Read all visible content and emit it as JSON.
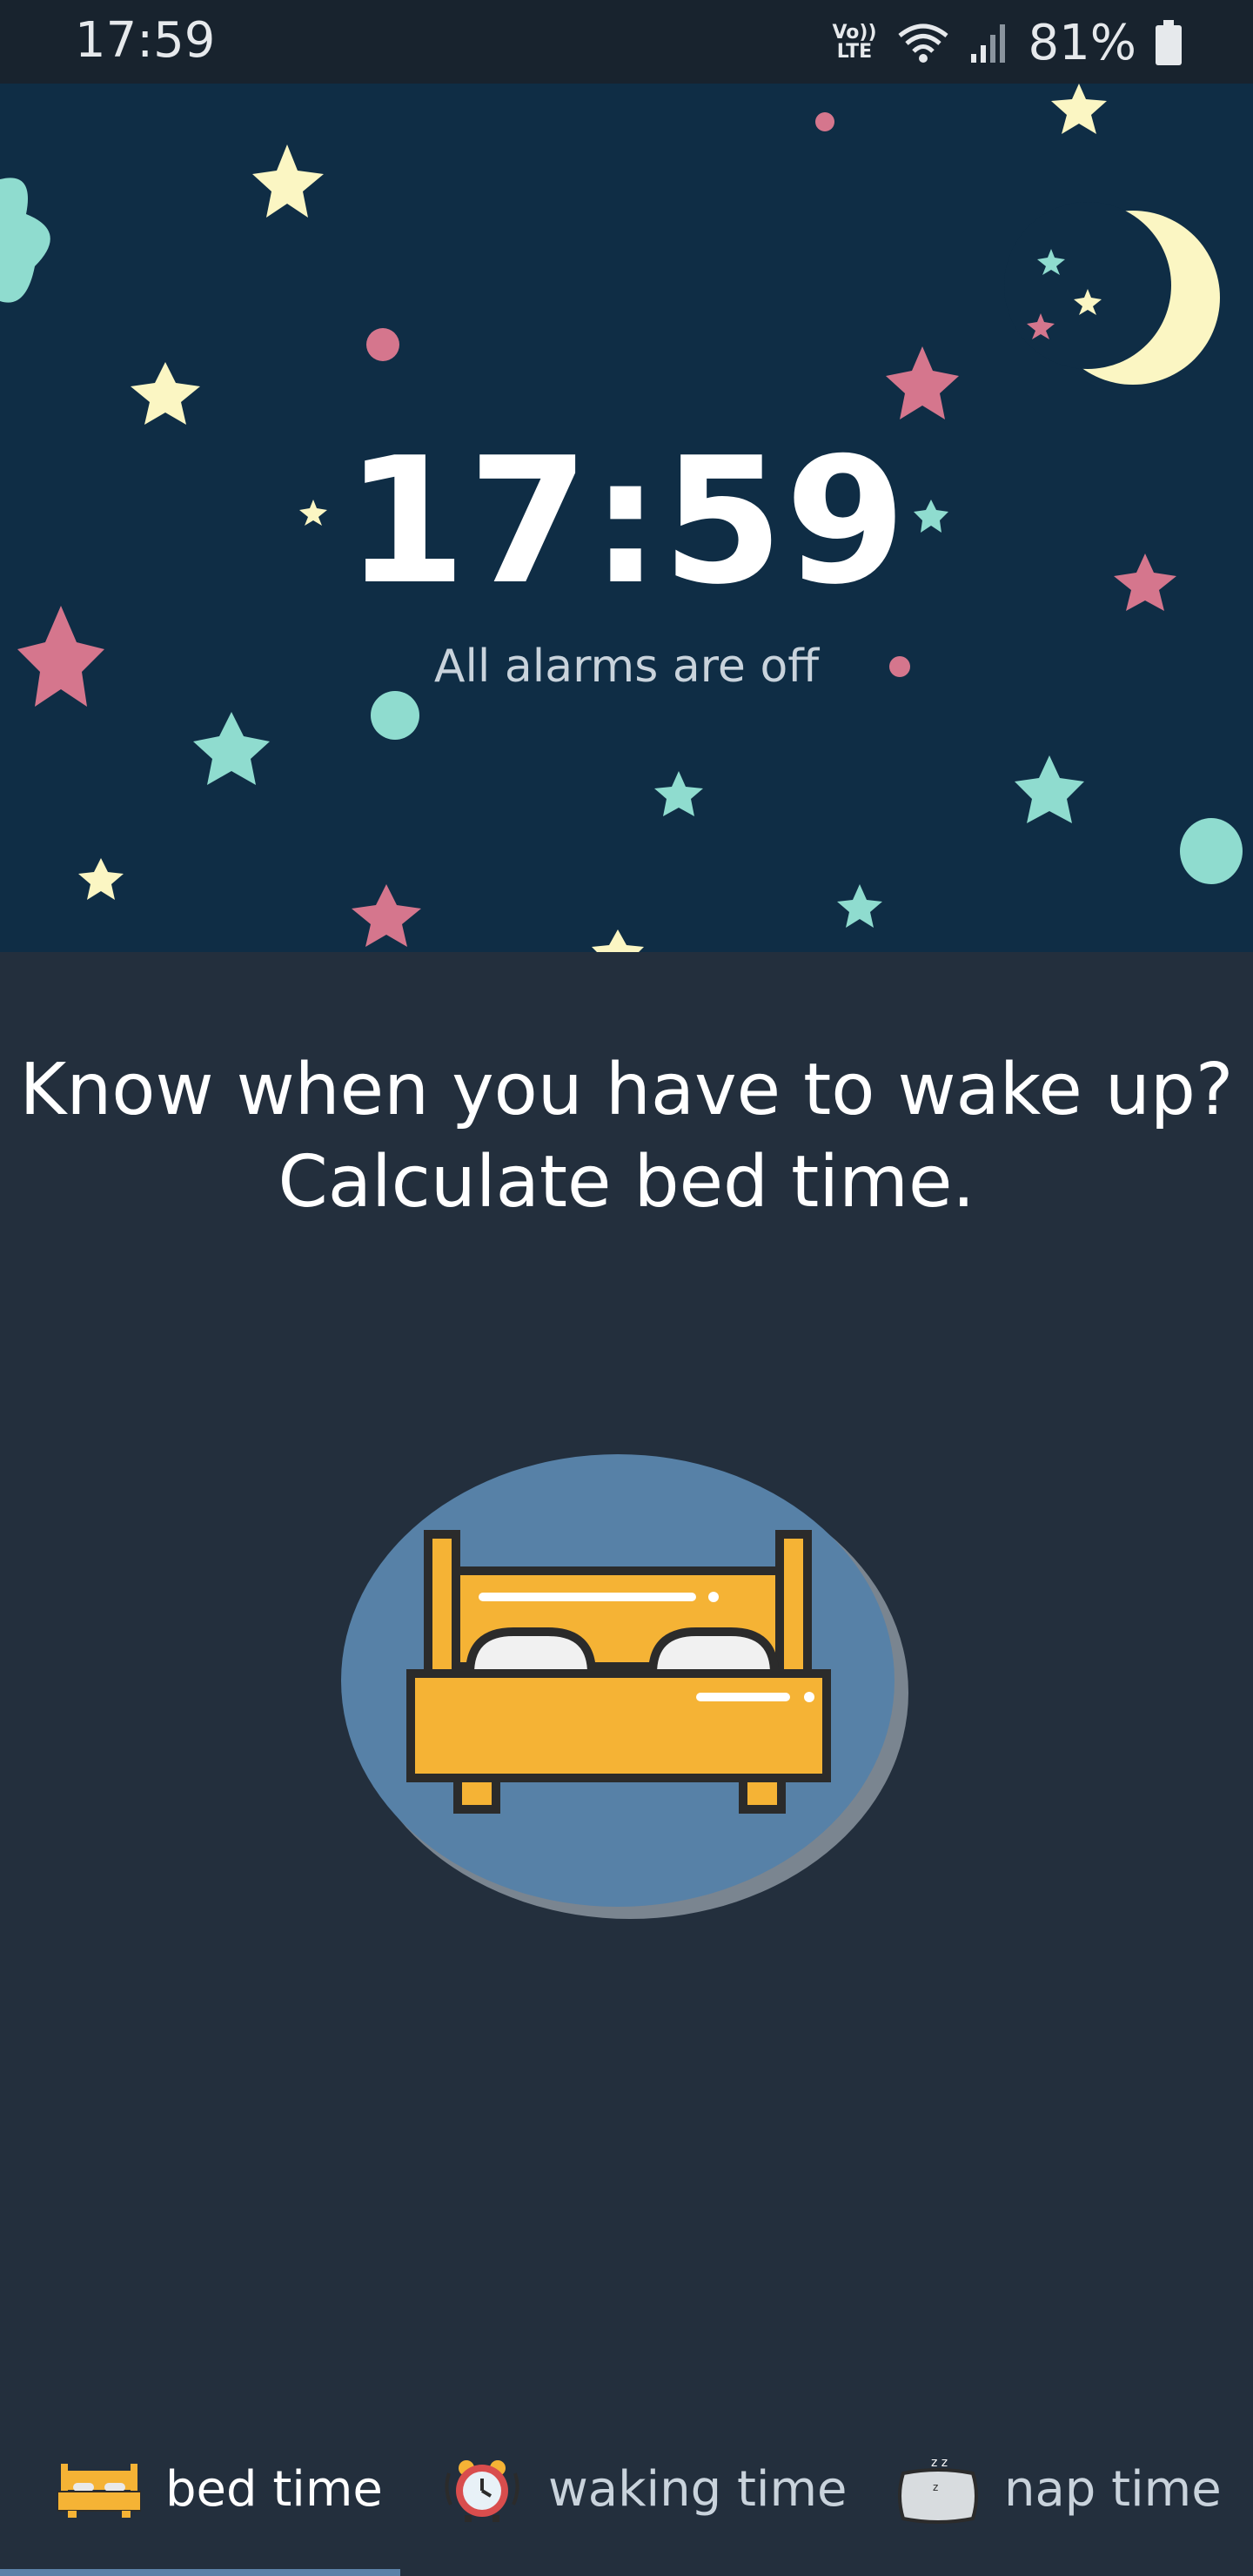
{
  "status_bar": {
    "time": "17:59",
    "network": "VoLTE",
    "volte_top": "Vo))",
    "volte_bottom": "LTE",
    "battery": "81%"
  },
  "header": {
    "clock": "17:59",
    "alarm_status": "All alarms are off"
  },
  "prompt": {
    "line1": "Know when you have to wake up?",
    "line2": "Calculate bed time."
  },
  "tabs": [
    {
      "label": "bed time",
      "icon": "bed-icon",
      "active": true
    },
    {
      "label": "waking time",
      "icon": "alarm-clock-icon",
      "active": false
    },
    {
      "label": "nap time",
      "icon": "pillow-icon",
      "active": false
    }
  ],
  "colors": {
    "background": "#232f3d",
    "header": "#0f2d45",
    "accent_teal": "#8fdccf",
    "accent_pink": "#d5768d",
    "accent_yellow": "#fbf6c3",
    "bed_orange": "#f5b335",
    "circle_blue": "#5781a7"
  }
}
